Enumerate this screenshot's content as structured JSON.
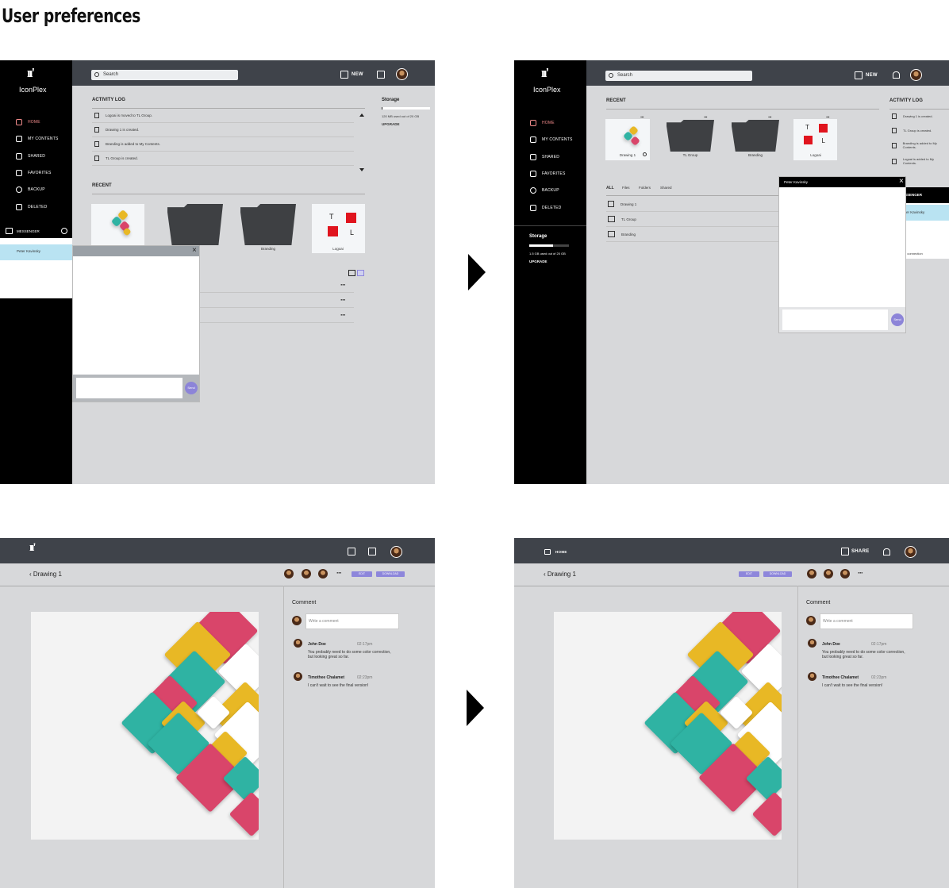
{
  "page_title": "User preferences",
  "app": {
    "name": "IconPlex"
  },
  "search_placeholder": "Search",
  "toolbar": {
    "new_label": "NEW",
    "share_label": "SHARE",
    "home_label": "HOME"
  },
  "nav": [
    "HOME",
    "MY CONTENTS",
    "SHARED",
    "FAVORITES",
    "BACKUP",
    "DELETED"
  ],
  "activity_log": {
    "title": "ACTIVITY LOG",
    "items": [
      "Logoai is moved to TL Group.",
      "Drawing 1 is created.",
      "Branding is added to My Contents.",
      "TL Group is created."
    ]
  },
  "activity_log_right": [
    "Drawing 1 is created.",
    "TL Group is created.",
    "Branding is added to My Contents.",
    "Logoai is added to My Contents."
  ],
  "storage": {
    "title": "Storage",
    "used_1": "120 MB used out of 20 GB",
    "used_2": "1.5 GB used out of 20 GB",
    "upgrade": "UPGRADE",
    "fill_1": 0.01,
    "fill_2": 0.6
  },
  "recent": {
    "title": "RECENT",
    "tiles": [
      "Drawing 1",
      "TL Group",
      "Branding",
      "Logoai"
    ]
  },
  "filters": [
    "ALL",
    "Files",
    "Folders",
    "Shared"
  ],
  "file_list": [
    "Drawing 1",
    "TL Group",
    "Branding"
  ],
  "messenger": {
    "title": "MESSENGER",
    "title_cut": "SSENGER",
    "contact": "Peter Kavinsky",
    "contact_cut": "er Kavinsky",
    "send": "Send",
    "connection_cut": "d connection"
  },
  "editor": {
    "back_title": "Drawing 1",
    "edit_label": "EDIT",
    "download_label": "DOWNLOAD",
    "comment_title": "Comment",
    "comment_placeholder": "Write a comment",
    "comments": [
      {
        "name": "John Doe",
        "time": "02:17pm",
        "text": "You probably need to do some color correction, but looking great so far."
      },
      {
        "name": "Timothee Chalamet",
        "time": "02:23pm",
        "text": "I can't wait to see the final version!"
      }
    ]
  },
  "colors": {
    "accent": "#8d86db",
    "sidebar": "#000000",
    "topbar": "#3f434a",
    "active_nav": "#f08a8a"
  }
}
